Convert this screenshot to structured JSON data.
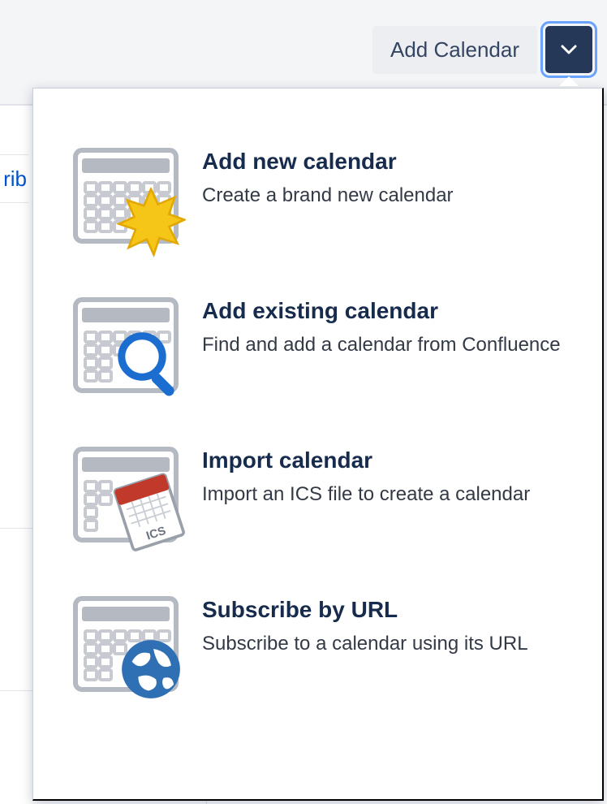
{
  "toolbar": {
    "add_calendar_label": "Add Calendar"
  },
  "left": {
    "partial_tab_text": "rib"
  },
  "dropdown": {
    "items": [
      {
        "title": "Add new calendar",
        "desc": "Create a brand new calendar"
      },
      {
        "title": "Add existing calendar",
        "desc": "Find and add a calendar from Confluence"
      },
      {
        "title": "Import calendar",
        "desc": "Import an ICS file to create a calendar"
      },
      {
        "title": "Subscribe by URL",
        "desc": "Subscribe to a calendar using its URL"
      }
    ]
  },
  "icons": {
    "ics_label": "ICS"
  },
  "colors": {
    "accent_star": "#f5c518",
    "accent_blue": "#1c6dd0",
    "accent_red": "#c0392b",
    "chevron_bg": "#253858",
    "focus_ring": "#6aa3ff",
    "title_text": "#172b4d"
  }
}
